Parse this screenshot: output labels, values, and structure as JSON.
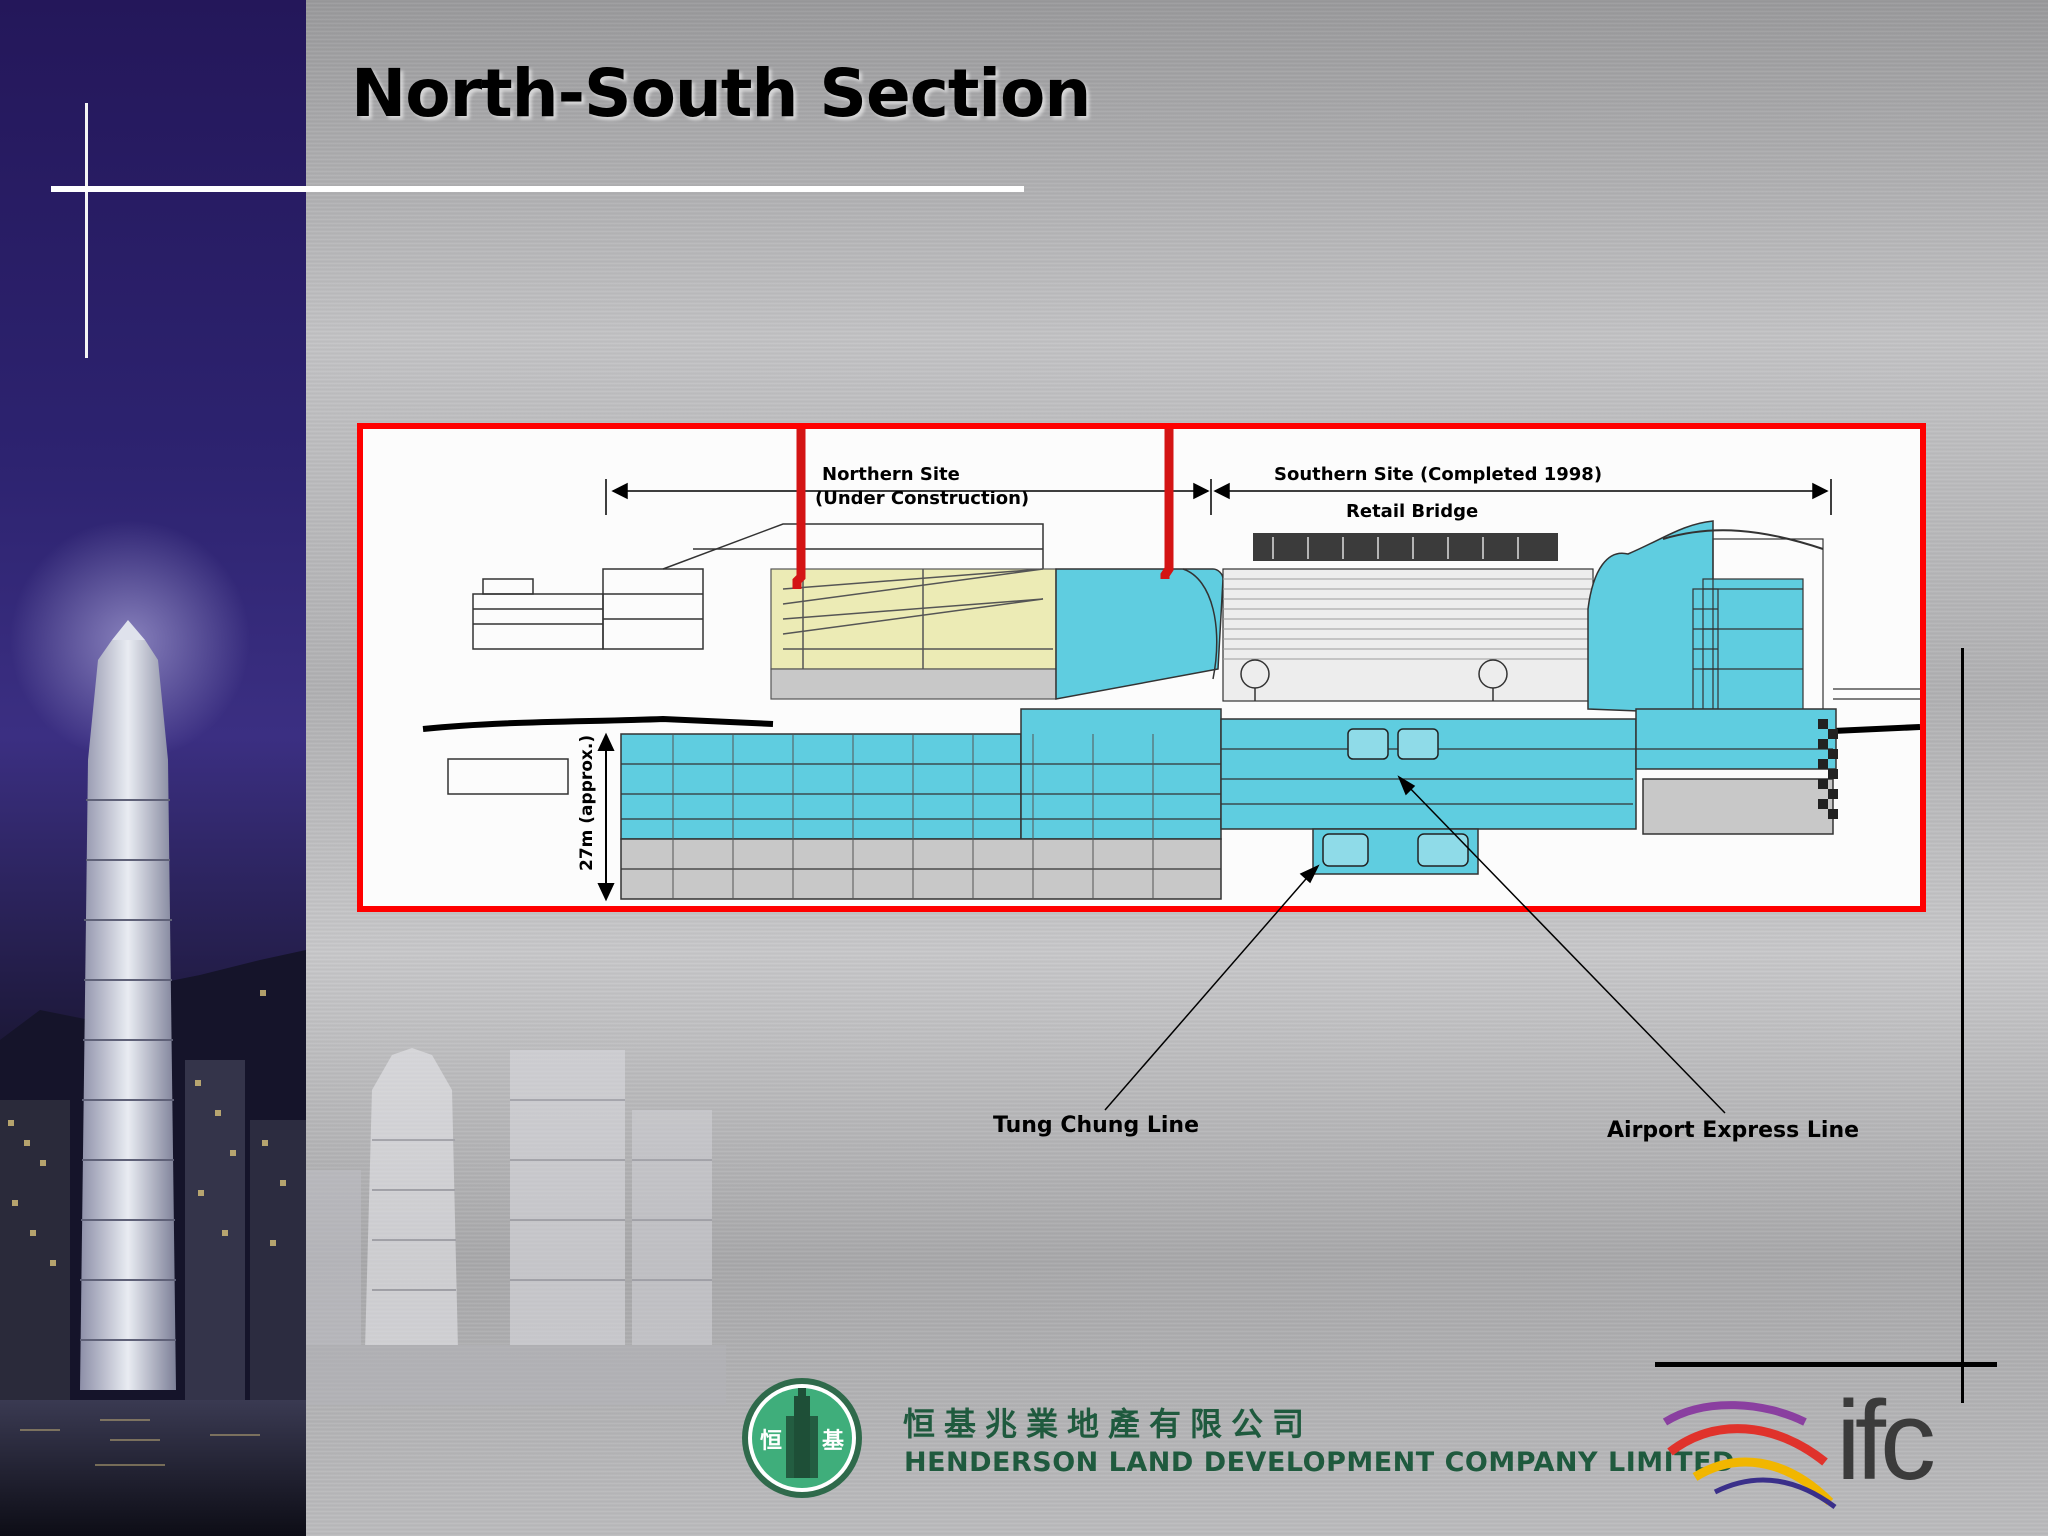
{
  "slide": {
    "title": "North-South Section"
  },
  "diagram": {
    "northern_site_line1": "Northern Site",
    "northern_site_line2": "(Under Construction)",
    "southern_site": "Southern Site (Completed 1998)",
    "retail_bridge": "Retail Bridge",
    "depth": "27m (approx.)",
    "colors": {
      "frame": "#ff0000",
      "cyan_fill": "#5fcde0",
      "yellow_fill": "#ecebb5",
      "gray_fill": "#c8c8c8"
    }
  },
  "callouts": {
    "tung_chung": "Tung Chung Line",
    "airport_express": "Airport Express Line"
  },
  "footer": {
    "company_cn": "恒基兆業地產有限公司",
    "company_en": "HENDERSON LAND DEVELOPMENT COMPANY LIMITED",
    "logo_left_char": "恒",
    "logo_right_char": "基",
    "ifc": "ifc"
  }
}
